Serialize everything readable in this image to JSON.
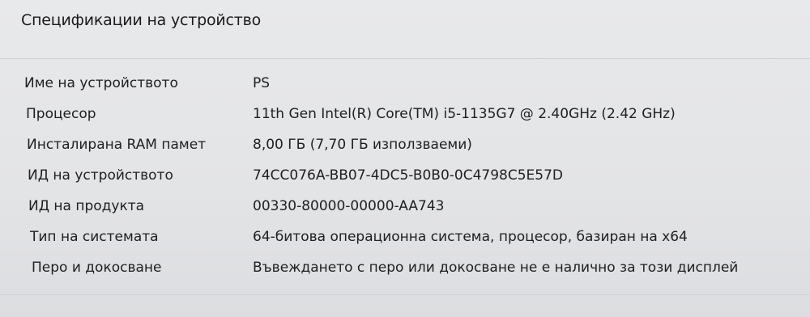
{
  "section": {
    "title": "Спецификации на устройство"
  },
  "specs": [
    {
      "label": "Име на устройството",
      "value": "PS"
    },
    {
      "label": "Процесор",
      "value": "11th Gen Intel(R) Core(TM) i5-1135G7 @ 2.40GHz (2.42 GHz)"
    },
    {
      "label": "Инсталирана RAM памет",
      "value": "8,00 ГБ (7,70 ГБ използваеми)"
    },
    {
      "label": "ИД на устройството",
      "value": "74CC076A-BB07-4DC5-B0B0-0C4798C5E57D"
    },
    {
      "label": "ИД на продукта",
      "value": "00330-80000-00000-AA743"
    },
    {
      "label": "Тип на системата",
      "value": "64-битова операционна система, процесор, базиран на x64"
    },
    {
      "label": "Перо и докосване",
      "value": "Въвеждането с перо или докосване не е налично за този дисплей"
    }
  ]
}
